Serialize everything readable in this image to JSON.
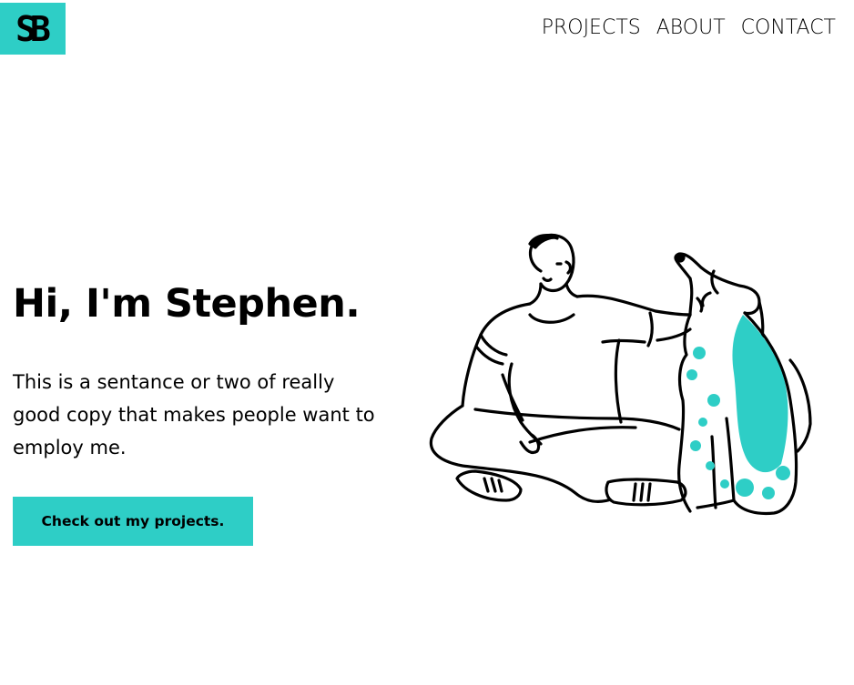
{
  "header": {
    "logo_text": "SB",
    "nav": [
      {
        "label": "PROJECTS"
      },
      {
        "label": "ABOUT"
      },
      {
        "label": "CONTACT"
      }
    ]
  },
  "hero": {
    "title": "Hi, I'm Stephen.",
    "copy": "This is a sentance or two of really good copy that makes people want to employ me.",
    "cta_label": "Check out my projects."
  },
  "colors": {
    "accent": "#2ecec6",
    "text": "#000000",
    "background": "#ffffff"
  },
  "illustration": {
    "icon": "man-with-dog-illustration"
  }
}
